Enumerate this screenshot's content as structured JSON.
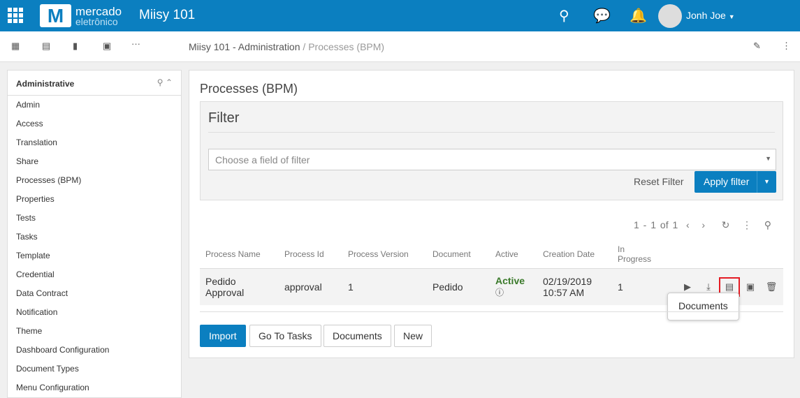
{
  "header": {
    "brand_top": "mercado",
    "brand_bottom": "eletrônico",
    "logo_letter": "M",
    "app_title": "Miisy 101",
    "user": "Jonh Joe"
  },
  "breadcrumb": {
    "parent": "Miisy 101 - Administration",
    "separator": "/",
    "current": "Processes (BPM)"
  },
  "sidebar": {
    "title": "Administrative",
    "items": [
      "Admin",
      "Access",
      "Translation",
      "Share",
      "Processes (BPM)",
      "Properties",
      "Tests",
      "Tasks",
      "Template",
      "Credential",
      "Data Contract",
      "Notification",
      "Theme",
      "Dashboard Configuration",
      "Document Types",
      "Menu Configuration"
    ]
  },
  "main": {
    "title": "Processes (BPM)",
    "filter": {
      "title": "Filter",
      "placeholder": "Choose a field of filter",
      "reset": "Reset Filter",
      "apply": "Apply filter"
    },
    "pager": "1 - 1 of 1",
    "columns": [
      "Process Name",
      "Process Id",
      "Process Version",
      "Document",
      "Active",
      "Creation Date",
      "In Progress"
    ],
    "rows": [
      {
        "name": "Pedido Approval",
        "id": "approval",
        "version": "1",
        "document": "Pedido",
        "active": "Active",
        "date": "02/19/2019",
        "time": "10:57 AM",
        "progress": "1"
      }
    ],
    "tooltip": "Documents",
    "buttons": {
      "import": "Import",
      "goto": "Go To Tasks",
      "documents": "Documents",
      "new": "New"
    }
  },
  "colors": {
    "primary": "#0b7fc0",
    "highlight": "#e41c24",
    "active": "#3a7a2a"
  }
}
